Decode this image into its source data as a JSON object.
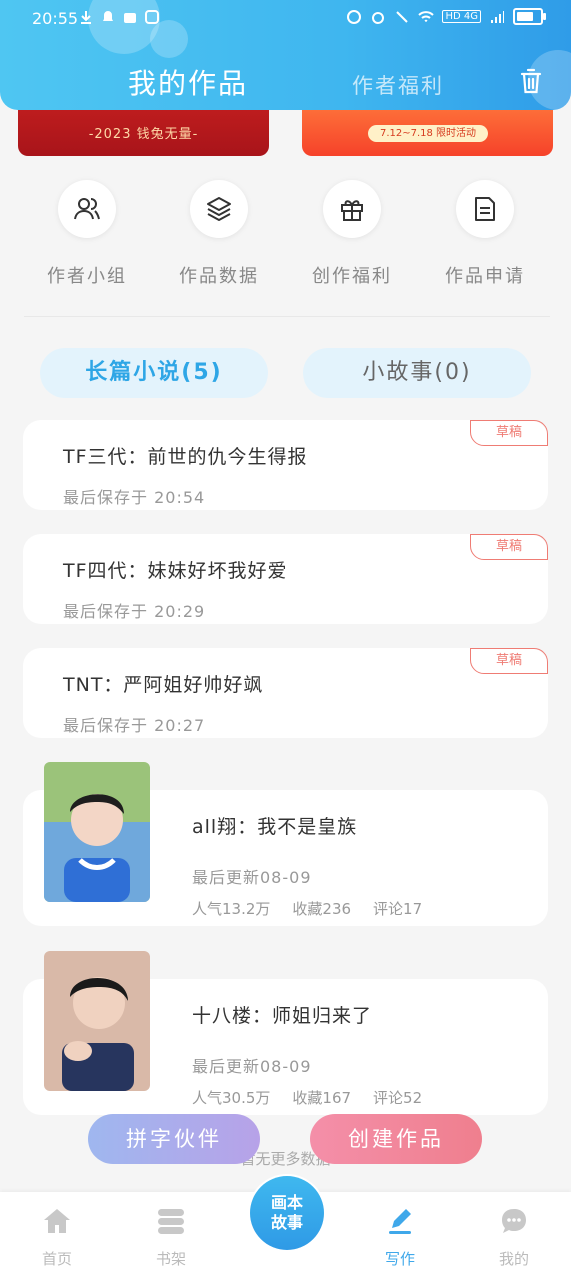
{
  "status_bar": {
    "time": "20:55",
    "network": "HD 4G"
  },
  "header": {
    "tab_works": "我的作品",
    "tab_welfare": "作者福利"
  },
  "banners": {
    "left_text": "-2023 钱兔无量-",
    "right_text": "7.12~7.18 限时活动"
  },
  "quick_actions": [
    {
      "label": "作者小组",
      "icon": "people-icon"
    },
    {
      "label": "作品数据",
      "icon": "layers-icon"
    },
    {
      "label": "创作福利",
      "icon": "gift-icon"
    },
    {
      "label": "作品申请",
      "icon": "document-icon"
    }
  ],
  "categories": {
    "long": "长篇小说(5)",
    "short": "小故事(0)"
  },
  "drafts": [
    {
      "title": "TF三代：前世的仇今生得报",
      "saved": "最后保存于 20:54",
      "badge": "草稿"
    },
    {
      "title": "TF四代：妹妹好坏我好爱",
      "saved": "最后保存于 20:29",
      "badge": "草稿"
    },
    {
      "title": "TNT：严阿姐好帅好飒",
      "saved": "最后保存于 20:27",
      "badge": "草稿"
    }
  ],
  "published": [
    {
      "title": "all翔：我不是皇族",
      "updated": "最后更新08-09",
      "popularity": "人气13.2万",
      "favorites": "收藏236",
      "comments": "评论17"
    },
    {
      "title": "十八楼：师姐归来了",
      "updated": "最后更新08-09",
      "popularity": "人气30.5万",
      "favorites": "收藏167",
      "comments": "评论52"
    }
  ],
  "floating_buttons": {
    "partner": "拼字伙伴",
    "create": "创建作品"
  },
  "footer_hint": "暂无更多数据",
  "bottom_nav": {
    "home": "首页",
    "shelf": "书架",
    "center_line1": "画本",
    "center_line2": "故事",
    "write": "写作",
    "me": "我的"
  },
  "colors": {
    "primary": "#3fb6ef",
    "draft_badge": "#ef7c74",
    "create_button": "#f48fa9",
    "partner_button": "#a9b0ec"
  }
}
